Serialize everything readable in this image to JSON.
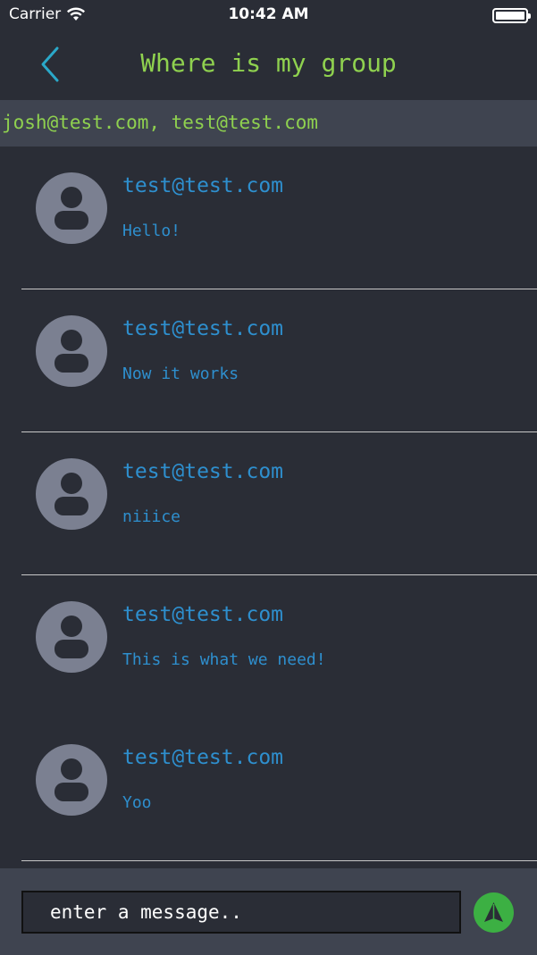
{
  "status_bar": {
    "carrier": "Carrier",
    "time": "10:42 AM",
    "battery_level": 1.0
  },
  "nav": {
    "title": "Where is my group",
    "back_icon": "chevron-left-icon",
    "accent_color": "#8fd14f",
    "back_color": "#2aa8c9"
  },
  "members": {
    "text": "josh@test.com, test@test.com"
  },
  "messages": [
    {
      "sender": "test@test.com",
      "text": "Hello!"
    },
    {
      "sender": "test@test.com",
      "text": "Now it works"
    },
    {
      "sender": "test@test.com",
      "text": "niiice"
    },
    {
      "sender": "test@test.com",
      "text": "This is what we need!"
    },
    {
      "sender": "test@test.com",
      "text": "Yoo"
    }
  ],
  "compose": {
    "placeholder": "enter a message..",
    "send_icon": "send-icon",
    "send_color": "#3cb043"
  },
  "colors": {
    "background": "#2a2d36",
    "bar": "#3f4450",
    "message_text": "#2e8fce",
    "avatar": "#7b8091"
  }
}
